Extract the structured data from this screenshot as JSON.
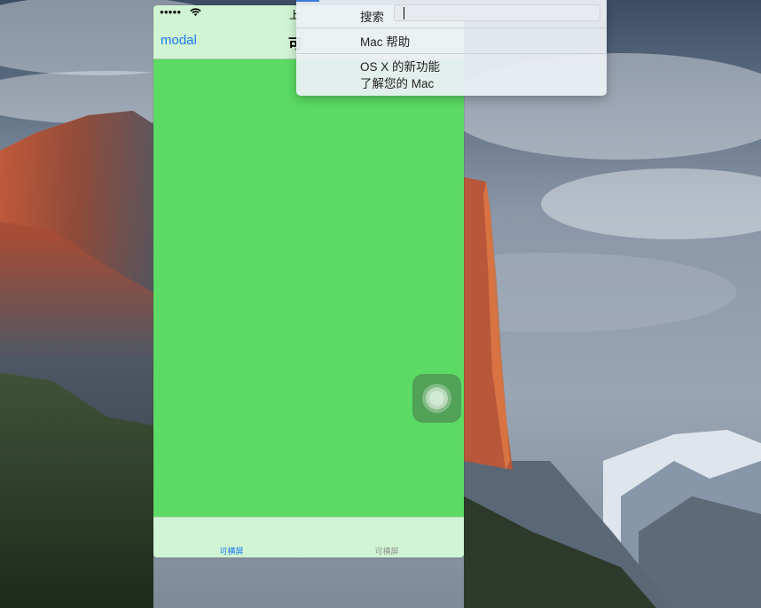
{
  "simulator": {
    "status": {
      "signal": "●●●●●",
      "time": "上"
    },
    "nav": {
      "left_button": "modal",
      "title": "可"
    },
    "tabs": [
      {
        "label": "可横屏",
        "selected": true
      },
      {
        "label": "可横屏",
        "selected": false
      }
    ],
    "colors": {
      "content": "#5bdb64",
      "bars": "#d1f5d4",
      "tint": "#1a7bf2"
    }
  },
  "help_menu": {
    "search_label": "搜索",
    "search_value": "",
    "items": [
      "Mac 帮助",
      "OS X 的新功能",
      "了解您的 Mac"
    ]
  }
}
